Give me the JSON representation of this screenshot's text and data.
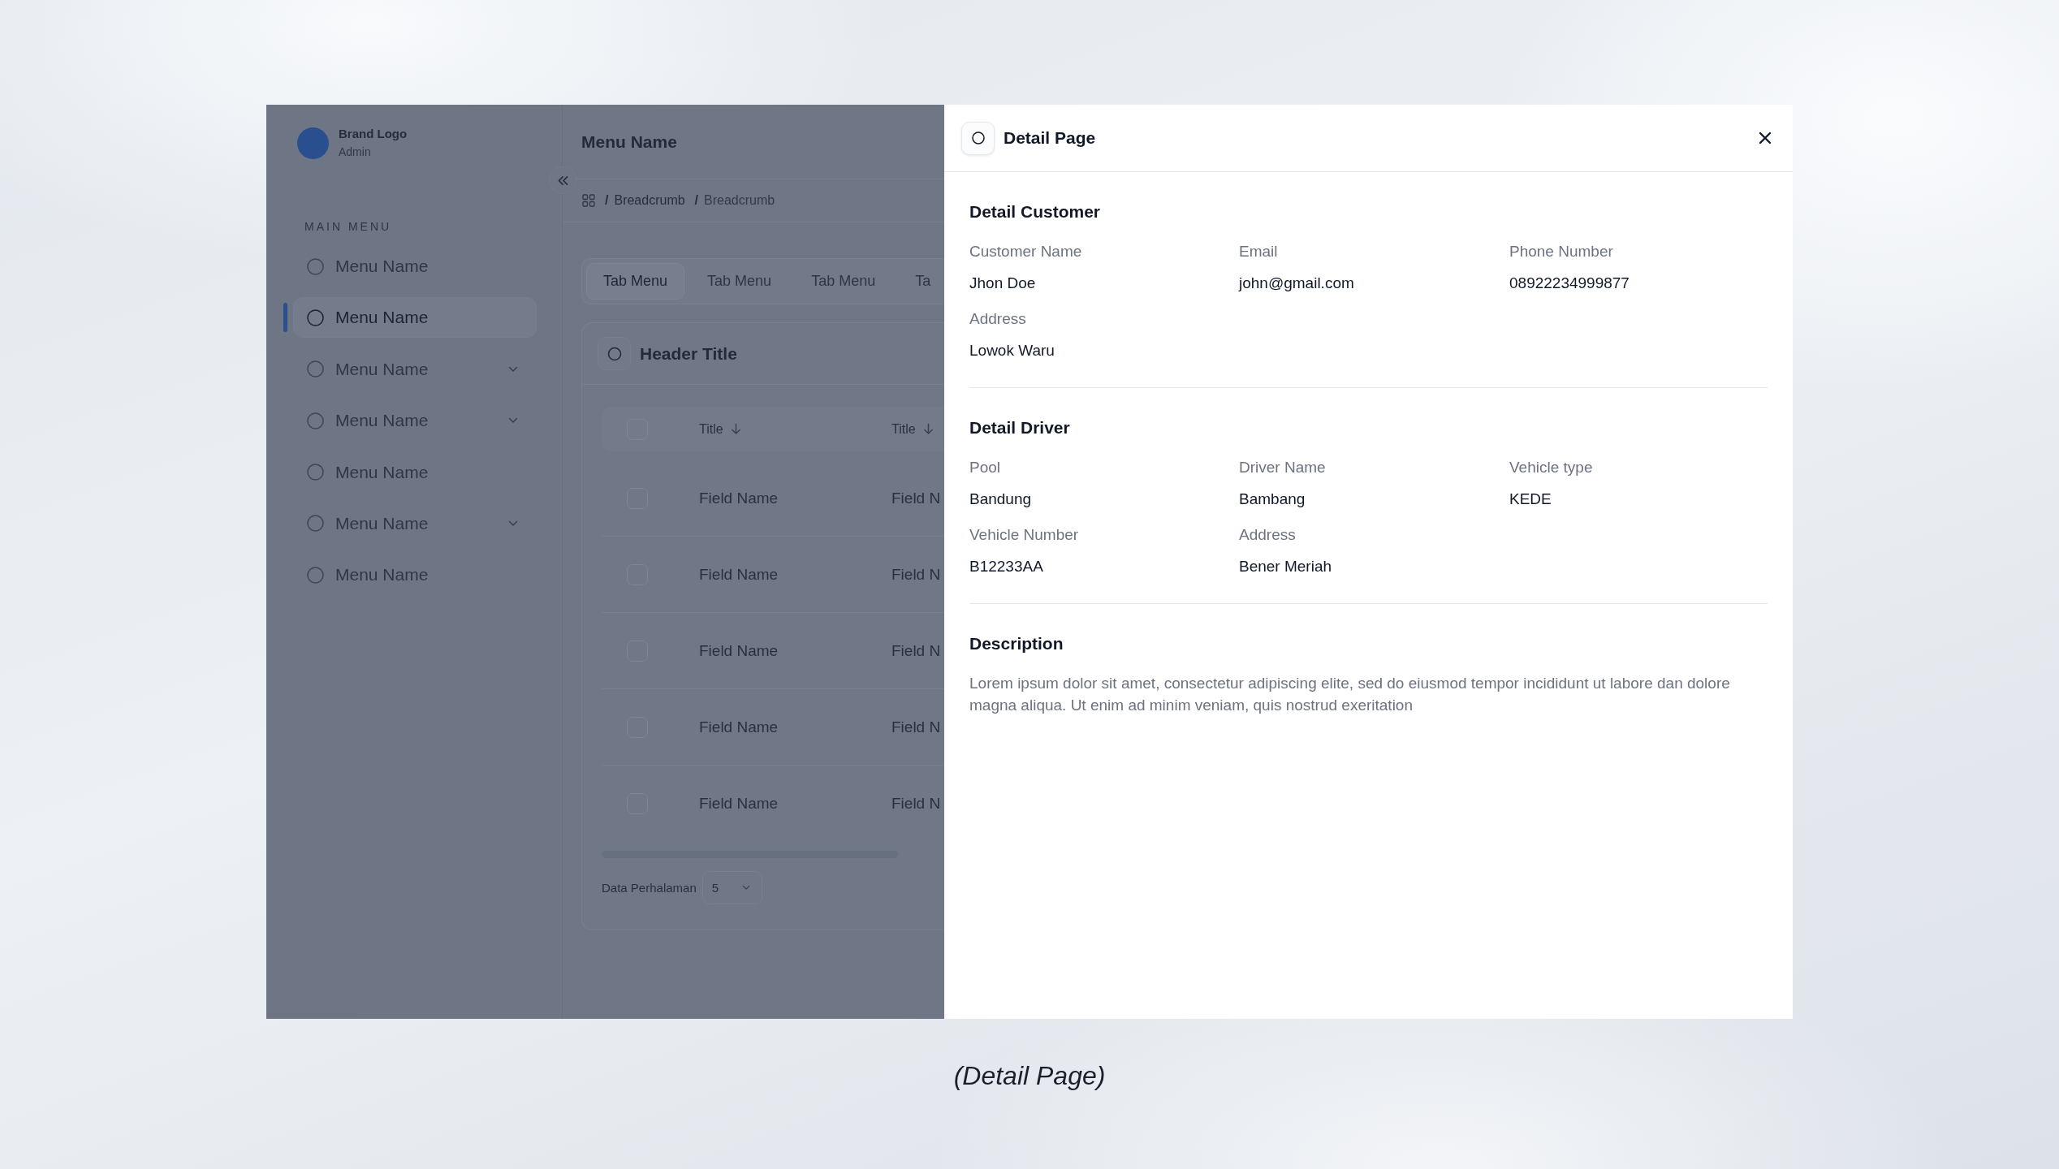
{
  "sidebar": {
    "brand": {
      "name": "Brand Logo",
      "role": "Admin"
    },
    "section_label": "MAIN MENU",
    "items": [
      {
        "label": "Menu Name",
        "selected": false,
        "expandable": false
      },
      {
        "label": "Menu Name",
        "selected": true,
        "expandable": false
      },
      {
        "label": "Menu Name",
        "selected": false,
        "expandable": true
      },
      {
        "label": "Menu Name",
        "selected": false,
        "expandable": true
      },
      {
        "label": "Menu Name",
        "selected": false,
        "expandable": false
      },
      {
        "label": "Menu Name",
        "selected": false,
        "expandable": true
      },
      {
        "label": "Menu Name",
        "selected": false,
        "expandable": false
      }
    ]
  },
  "header": {
    "title": "Menu Name",
    "breadcrumb": [
      {
        "separator": "/",
        "label": "Breadcrumb",
        "current": false
      },
      {
        "separator": "/",
        "label": "Breadcrumb",
        "current": true
      }
    ]
  },
  "tabs": [
    {
      "label": "Tab Menu",
      "selected": true
    },
    {
      "label": "Tab Menu",
      "selected": false
    },
    {
      "label": "Tab Menu",
      "selected": false
    },
    {
      "label": "Ta",
      "selected": false
    }
  ],
  "card": {
    "title": "Header Title",
    "table": {
      "all_checked": false,
      "columns": [
        {
          "label": "Title",
          "sort_descending": true
        },
        {
          "label": "Title",
          "sort_descending": true
        }
      ],
      "rows": [
        {
          "checked": false,
          "cells": [
            "Field Name",
            "Field N"
          ]
        },
        {
          "checked": false,
          "cells": [
            "Field Name",
            "Field N"
          ]
        },
        {
          "checked": false,
          "cells": [
            "Field Name",
            "Field N"
          ]
        },
        {
          "checked": false,
          "cells": [
            "Field Name",
            "Field N"
          ]
        },
        {
          "checked": false,
          "cells": [
            "Field Name",
            "Field N"
          ]
        }
      ]
    },
    "footer": {
      "label": "Data Perhalaman",
      "page_size": "5"
    }
  },
  "detail": {
    "title": "Detail Page",
    "sections": [
      {
        "kind": "fields",
        "title": "Detail Customer",
        "fields": [
          {
            "label": "Customer Name",
            "value": "Jhon Doe"
          },
          {
            "label": "Email",
            "value": "john@gmail.com"
          },
          {
            "label": "Phone Number",
            "value": "08922234999877"
          },
          {
            "label": "Address",
            "value": "Lowok Waru"
          }
        ]
      },
      {
        "kind": "fields",
        "title": "Detail Driver",
        "fields": [
          {
            "label": "Pool",
            "value": "Bandung"
          },
          {
            "label": "Driver Name",
            "value": "Bambang"
          },
          {
            "label": "Vehicle type",
            "value": "KEDE"
          },
          {
            "label": "Vehicle Number",
            "value": "B12233AA"
          },
          {
            "label": "Address",
            "value": "Bener Meriah"
          }
        ]
      },
      {
        "kind": "text",
        "title": "Description",
        "text": "Lorem ipsum dolor sit amet, consectetur adipiscing elite, sed do eiusmod tempor incididunt ut labore dan dolore magna aliqua. Ut enim ad minim veniam, quis nostrud exeritation"
      }
    ]
  },
  "caption": "(Detail Page)"
}
